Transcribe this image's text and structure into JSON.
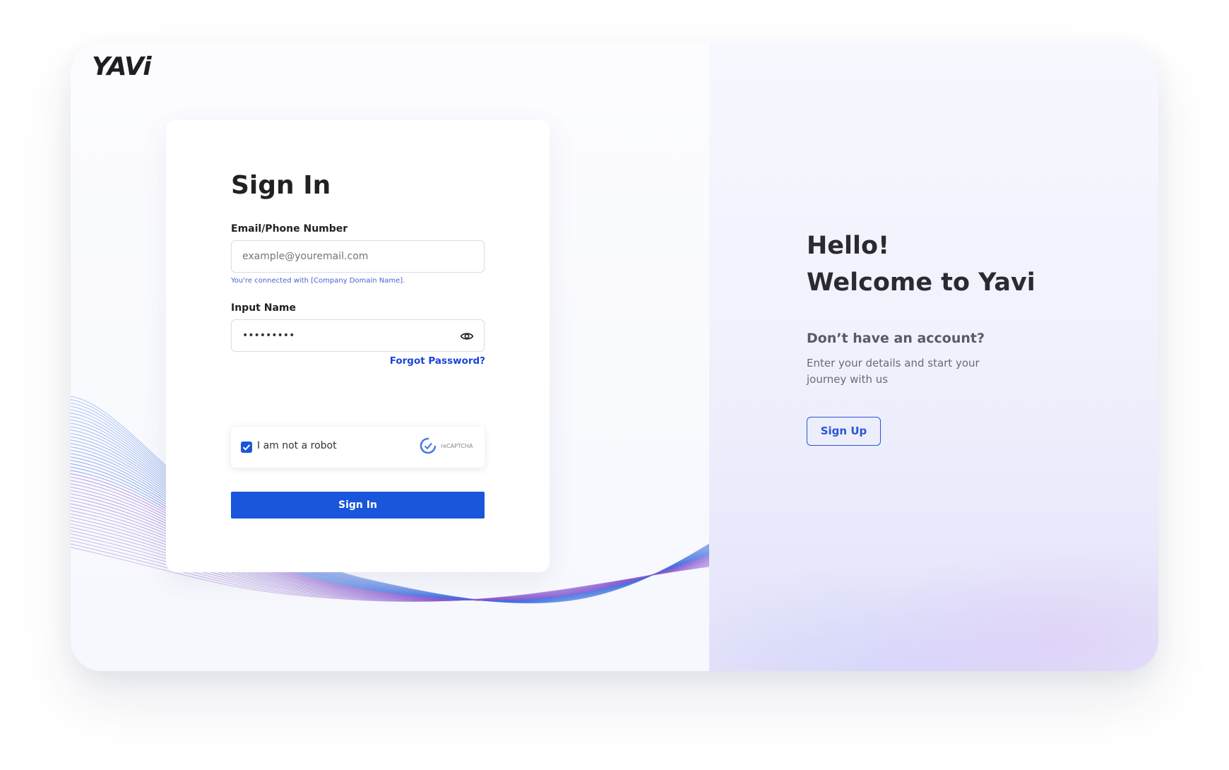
{
  "brand": {
    "logo_text": "YAVi"
  },
  "signin": {
    "title": "Sign In",
    "email_label": "Email/Phone Number",
    "email_placeholder": "example@youremail.com",
    "connected_hint": "You're connected with [Company Domain Name].",
    "password_label": "Input Name",
    "password_value": "•••••••••",
    "forgot_link": "Forgot Password?",
    "captcha_label": "I am not a robot",
    "captcha_checked": true,
    "captcha_brand": "reCAPTCHA",
    "submit_label": "Sign In"
  },
  "welcome": {
    "line1": "Hello!",
    "line2": "Welcome to Yavi",
    "prompt": "Don’t have an account?",
    "description": "Enter your details and start your journey with us",
    "signup_label": "Sign Up"
  },
  "colors": {
    "primary": "#1a56db",
    "link": "#1a46d6",
    "wave_blue": "#3f6fe0",
    "wave_purple": "#8a58cf"
  }
}
